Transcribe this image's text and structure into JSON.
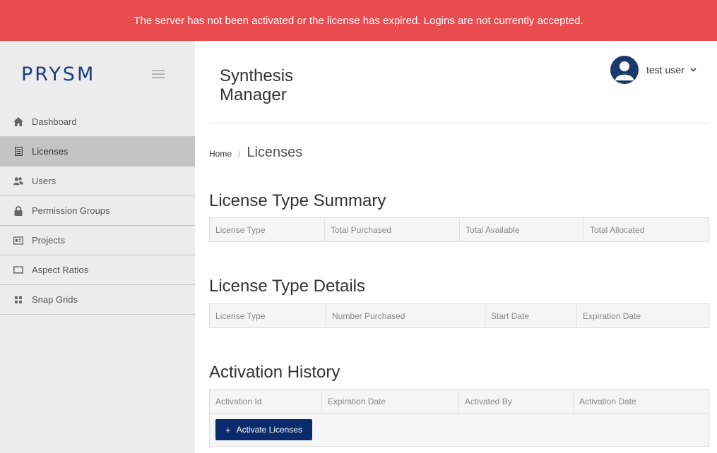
{
  "banner": {
    "message": "The server has not been activated or the license has expired. Logins are not currently accepted."
  },
  "sidebar": {
    "logo": "PRYSM",
    "items": [
      {
        "label": "Dashboard",
        "icon": "home-icon"
      },
      {
        "label": "Licenses",
        "icon": "document-icon",
        "active": true
      },
      {
        "label": "Users",
        "icon": "users-icon"
      },
      {
        "label": "Permission Groups",
        "icon": "lock-icon"
      },
      {
        "label": "Projects",
        "icon": "id-card-icon"
      },
      {
        "label": "Aspect Ratios",
        "icon": "rectangle-icon"
      },
      {
        "label": "Snap Grids",
        "icon": "grid-icon"
      }
    ]
  },
  "header": {
    "app_title_line1": "Synthesis",
    "app_title_line2": "Manager",
    "user_name": "test user"
  },
  "breadcrumb": {
    "home": "Home",
    "separator": "/",
    "current": "Licenses"
  },
  "summary": {
    "title": "License Type Summary",
    "columns": [
      "License Type",
      "Total Purchased",
      "Total Available",
      "Total Allocated"
    ]
  },
  "details": {
    "title": "License Type Details",
    "columns": [
      "License Type",
      "Number Purchased",
      "Start Date",
      "Expiration Date"
    ]
  },
  "history": {
    "title": "Activation History",
    "columns": [
      "Activation Id",
      "Expiration Date",
      "Activated By",
      "Activation Date"
    ],
    "button_label": "Activate Licenses",
    "button_icon": "+"
  },
  "colors": {
    "banner": "#e84c4f",
    "brand": "#1a3b82",
    "button": "#0a2b6b"
  }
}
